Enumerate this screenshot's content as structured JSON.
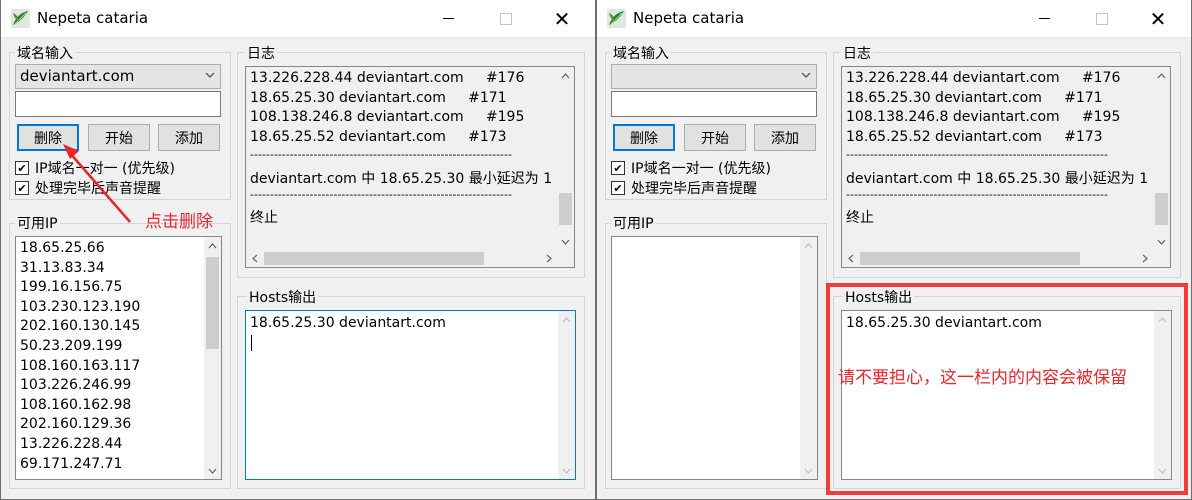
{
  "colors": {
    "accent": "#0078d7",
    "annotation": "#e8262c",
    "window_bg": "#f0f0f0",
    "icon_green": "#2e7d32"
  },
  "left": {
    "title": "Nepeta cataria",
    "domain_group_label": "域名输入",
    "domain_selected": "deviantart.com",
    "domain_text": "",
    "btn_delete": "删除",
    "btn_start": "开始",
    "btn_add": "添加",
    "check_ip_one_to_one": "IP域名一对一 (优先级)",
    "check_sound": "处理完毕后声音提醒",
    "available_ip_label": "可用IP",
    "available_ips": [
      "18.65.25.66",
      "31.13.83.34",
      "199.16.156.75",
      "103.230.123.190",
      "202.160.130.145",
      "50.23.209.199",
      "108.160.163.117",
      "103.226.246.99",
      "108.160.162.98",
      "202.160.129.36",
      "13.226.228.44",
      "69.171.247.71"
    ],
    "log_label": "日志",
    "log_lines": [
      "13.226.228.44 deviantart.com     #176",
      "18.65.25.30 deviantart.com     #171",
      "108.138.246.8 deviantart.com     #195",
      "18.65.25.52 deviantart.com     #173",
      "------------------------------------------------------------------",
      "deviantart.com 中 18.65.25.30 最小延迟为 1",
      "------------------------------------------------------------------",
      "终止"
    ],
    "hosts_label": "Hosts输出",
    "hosts_text": "18.65.25.30 deviantart.com",
    "annotation": "点击删除"
  },
  "right": {
    "title": "Nepeta cataria",
    "domain_group_label": "域名输入",
    "domain_selected": "",
    "domain_text": "",
    "btn_delete": "删除",
    "btn_start": "开始",
    "btn_add": "添加",
    "check_ip_one_to_one": "IP域名一对一 (优先级)",
    "check_sound": "处理完毕后声音提醒",
    "available_ip_label": "可用IP",
    "available_ips": [],
    "log_label": "日志",
    "log_lines": [
      "13.226.228.44 deviantart.com     #176",
      "18.65.25.30 deviantart.com     #171",
      "108.138.246.8 deviantart.com     #195",
      "18.65.25.52 deviantart.com     #173",
      "------------------------------------------------------------------",
      "deviantart.com 中 18.65.25.30 最小延迟为 1",
      "------------------------------------------------------------------",
      "终止"
    ],
    "hosts_label": "Hosts输出",
    "hosts_text": "18.65.25.30 deviantart.com",
    "annotation": "请不要担心，这一栏内的内容会被保留"
  },
  "icons": {
    "window_close": "✕",
    "scroll_up": "▲",
    "scroll_down": "▼",
    "scroll_left": "◀",
    "scroll_right": "▶",
    "combo_arrow": "⌄",
    "check_mark": "✔"
  }
}
